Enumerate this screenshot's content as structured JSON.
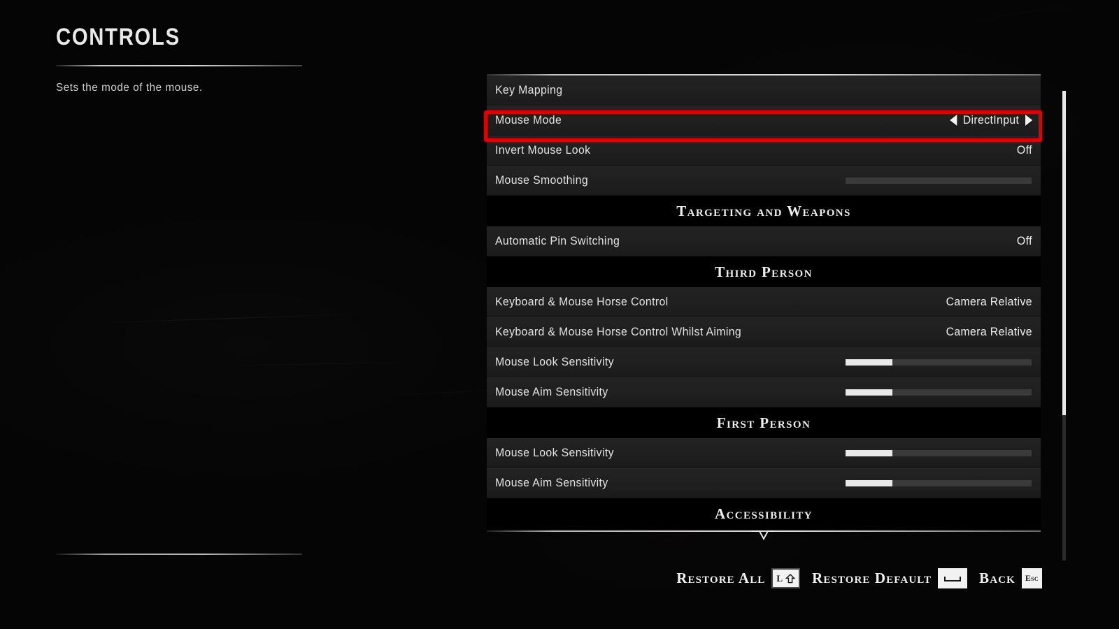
{
  "left": {
    "title": "CONTROLS",
    "description": "Sets the mode of the mouse."
  },
  "list": {
    "items": [
      {
        "kind": "row",
        "label": "Key Mapping",
        "value_type": "none"
      },
      {
        "kind": "row",
        "label": "Mouse Mode",
        "value_type": "spinner",
        "value": "DirectInput",
        "highlighted": true
      },
      {
        "kind": "row",
        "label": "Invert Mouse Look",
        "value_type": "text",
        "value": "Off"
      },
      {
        "kind": "row",
        "label": "Mouse Smoothing",
        "value_type": "slider",
        "value": 0
      },
      {
        "kind": "header",
        "label": "Targeting and Weapons"
      },
      {
        "kind": "row",
        "label": "Automatic Pin Switching",
        "value_type": "text",
        "value": "Off"
      },
      {
        "kind": "header",
        "label": "Third Person"
      },
      {
        "kind": "row",
        "label": "Keyboard & Mouse Horse Control",
        "value_type": "text",
        "value": "Camera Relative"
      },
      {
        "kind": "row",
        "label": "Keyboard & Mouse Horse Control Whilst Aiming",
        "value_type": "text",
        "value": "Camera Relative"
      },
      {
        "kind": "row",
        "label": "Mouse Look Sensitivity",
        "value_type": "slider",
        "value": 25
      },
      {
        "kind": "row",
        "label": "Mouse Aim Sensitivity",
        "value_type": "slider",
        "value": 25
      },
      {
        "kind": "header",
        "label": "First Person"
      },
      {
        "kind": "row",
        "label": "Mouse Look Sensitivity",
        "value_type": "slider",
        "value": 25
      },
      {
        "kind": "row",
        "label": "Mouse Aim Sensitivity",
        "value_type": "slider",
        "value": 25
      },
      {
        "kind": "header",
        "label": "Accessibility"
      }
    ]
  },
  "scrollbar": {
    "thumb_top_pct": 0,
    "thumb_height_pct": 69
  },
  "footer": {
    "actions": [
      {
        "label": "Restore All",
        "key_icon": "lshift-key-icon",
        "key_text": "L"
      },
      {
        "label": "Restore Default",
        "key_icon": "spacebar-key-icon",
        "key_text": ""
      },
      {
        "label": "Back",
        "key_icon": "esc-key-icon",
        "key_text": "Esc"
      }
    ]
  },
  "annotation": {
    "target": "Mouse Mode",
    "color": "#e00000"
  },
  "icons": {
    "chevron_left": "chevron-left-icon",
    "chevron_right": "chevron-right-icon",
    "scroll_down": "scroll-down-chevron-icon"
  }
}
